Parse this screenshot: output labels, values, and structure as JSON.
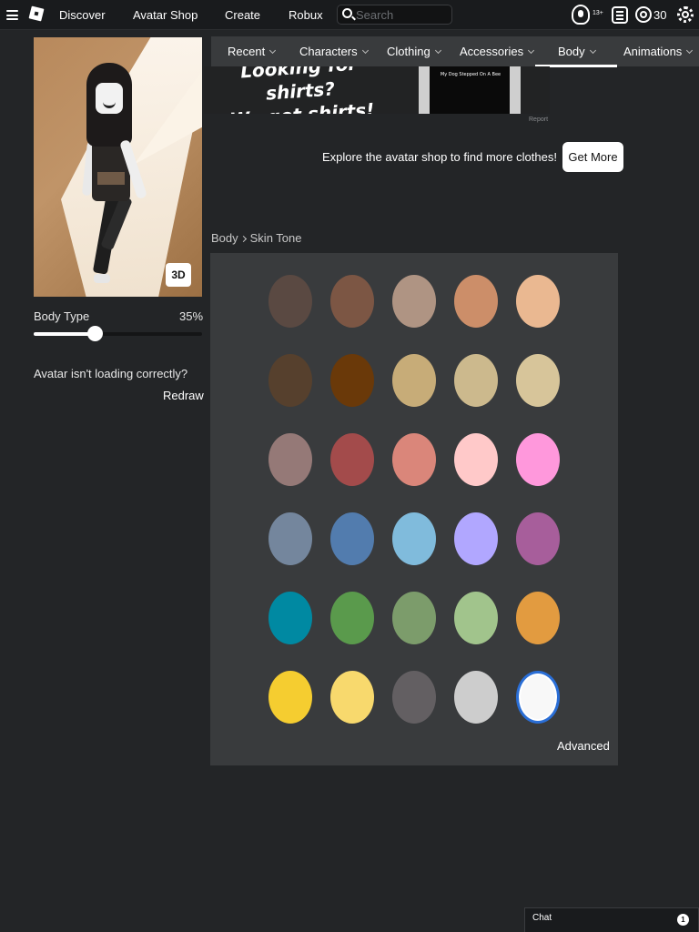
{
  "nav": {
    "links": [
      "Discover",
      "Avatar Shop",
      "Create",
      "Robux"
    ],
    "search_placeholder": "Search",
    "age_badge": "13+",
    "robux_balance": "30"
  },
  "avatar": {
    "view_mode_button": "3D",
    "body_type_label": "Body Type",
    "body_type_value": "35%",
    "body_type_fraction": 0.35,
    "loading_message": "Avatar isn't loading correctly?",
    "redraw_label": "Redraw"
  },
  "tabs": [
    {
      "label": "Recent",
      "selected": false
    },
    {
      "label": "Characters",
      "selected": false
    },
    {
      "label": "Clothing",
      "selected": false
    },
    {
      "label": "Accessories",
      "selected": false
    },
    {
      "label": "Body",
      "selected": true
    },
    {
      "label": "Animations",
      "selected": false
    }
  ],
  "ad": {
    "headline_line1": "Looking for shirts?",
    "headline_line2": "We got shirts!",
    "shirt_text": "My Dog Stepped On A Bee",
    "report_label": "Report"
  },
  "promo": {
    "message": "Explore the avatar shop to find more clothes!",
    "button_label": "Get More"
  },
  "breadcrumb": {
    "root": "Body",
    "current": "Skin Tone"
  },
  "skin_tones": {
    "selected_color": "#f8f8f8",
    "rows": [
      [
        "#5a4942",
        "#7c5644",
        "#af9483",
        "#cc8e69",
        "#eab891"
      ],
      [
        "#56402d",
        "#6a3909",
        "#c7ac78",
        "#ccb98d",
        "#d7c59a"
      ],
      [
        "#957977",
        "#a34b4b",
        "#da867a",
        "#ffc9c9",
        "#ff98dc"
      ],
      [
        "#74869d",
        "#527cae",
        "#80bbdc",
        "#b1a7ff",
        "#a75e9b"
      ],
      [
        "#0089a2",
        "#5a9a4c",
        "#7c9c6b",
        "#a1c48c",
        "#e29b40"
      ],
      [
        "#f5cd30",
        "#f8d96d",
        "#635f62",
        "#cdcdcd",
        "#f8f8f8"
      ]
    ],
    "advanced_label": "Advanced"
  },
  "chat": {
    "label": "Chat",
    "unread_count": "1"
  }
}
